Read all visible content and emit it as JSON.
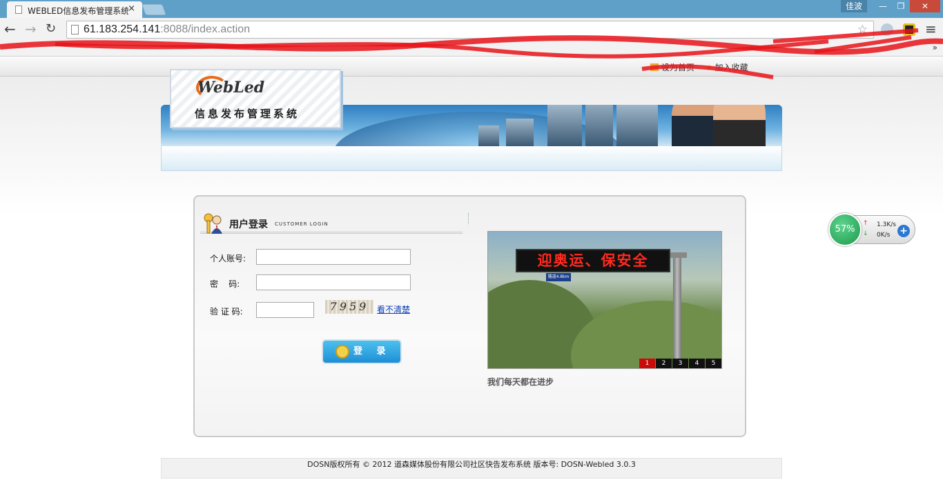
{
  "browser": {
    "tab_title": "WEBLED信息发布管理系统",
    "tab_close": "×",
    "user_name": "佳波",
    "url_host": "61.183.254.141",
    "url_rest": ":8088/index.action",
    "bookmarks_more": "»",
    "win_min": "—",
    "win_max": "❐",
    "win_close": "✕"
  },
  "header": {
    "set_home": "设为首页",
    "add_favorite": "加入收藏",
    "logo_brand": "WebLed",
    "logo_subtitle": "信息发布管理系统"
  },
  "login": {
    "title": "用户登录",
    "title_en": "CUSTOMER LOGIN",
    "account_label": "个人账号:",
    "password_label": "密    码:",
    "captcha_label": "验 证 码:",
    "account_value": "",
    "password_value": "",
    "captcha_value": "",
    "captcha_image_text": "7959",
    "captcha_refresh": "看不清楚",
    "submit": "登 录"
  },
  "slideshow": {
    "sign_text": "迎奥运、保安全",
    "sign_subtext": "隧道4.8km",
    "tabs": [
      "1",
      "2",
      "3",
      "4",
      "5"
    ],
    "active_tab": 1,
    "caption": "我们每天都在进步"
  },
  "footer": {
    "copyright": "DOSN版权所有 © 2012 道森媒体股份有限公司社区快告发布系统 版本号: DOSN-Webled 3.0.3"
  },
  "net_monitor": {
    "percent": "57%",
    "upload": "1.3K/s",
    "download": "0K/s"
  }
}
